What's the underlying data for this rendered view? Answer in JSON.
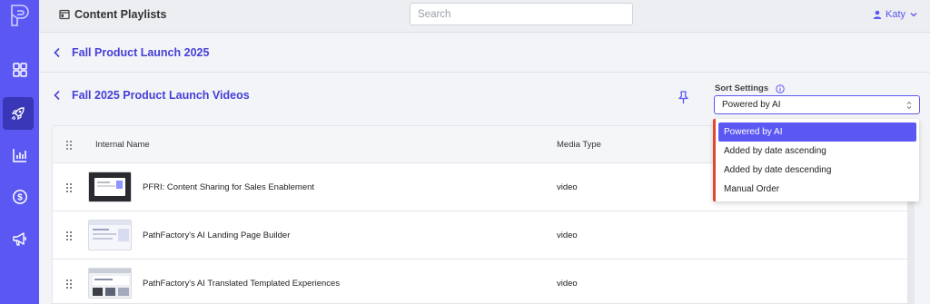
{
  "topbar": {
    "title": "Content Playlists",
    "search_placeholder": "Search",
    "user": "Katy"
  },
  "breadcrumb": {
    "title": "Fall Product Launch 2025"
  },
  "subheader": {
    "title": "Fall 2025 Product Launch Videos"
  },
  "sort": {
    "label": "Sort Settings",
    "selected": "Powered by AI",
    "options": [
      "Powered by AI",
      "Added by date ascending",
      "Added by date descending",
      "Manual Order"
    ]
  },
  "table": {
    "columns": [
      "Internal Name",
      "Media Type"
    ],
    "rows": [
      {
        "name": "PFRI: Content Sharing for Sales Enablement",
        "type": "video"
      },
      {
        "name": "PathFactory's AI Landing Page Builder",
        "type": "video"
      },
      {
        "name": "PathFactory's AI Translated Templated Experiences",
        "type": "video"
      }
    ]
  },
  "colors": {
    "accent": "#5b57f3",
    "link": "#4540d6",
    "dropdown_border": "#e0482f"
  },
  "icons": {
    "sidebar": [
      "pathfactory-logo-icon",
      "dashboard-grid-icon",
      "rocket-icon",
      "analytics-chart-icon",
      "dollar-icon",
      "megaphone-icon"
    ],
    "topbar": [
      "playlist-icon",
      "user-icon",
      "chevron-down-icon"
    ],
    "page": [
      "back-chevron-icon",
      "pin-icon",
      "info-icon",
      "select-caret-icon",
      "drag-handle-icon"
    ]
  }
}
